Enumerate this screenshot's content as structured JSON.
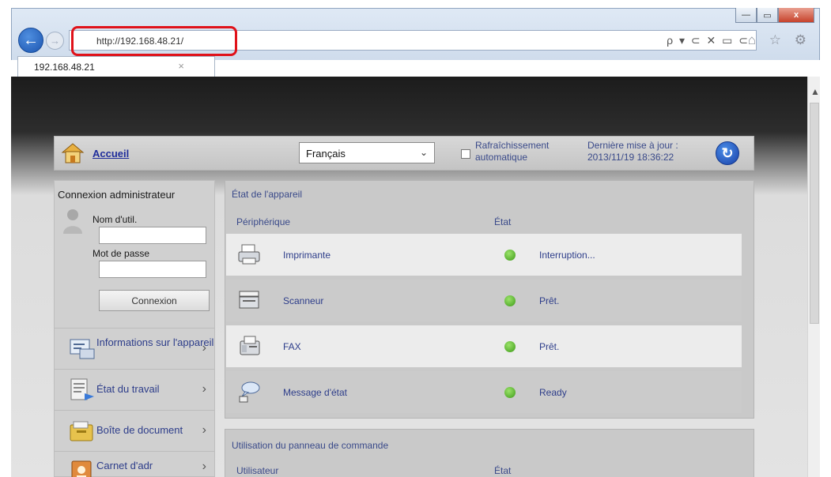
{
  "browser": {
    "url": "http://192.168.48.21/",
    "tab_label": "192.168.48.21",
    "tab_close": "×",
    "address_icons": "ρ ▾ ⊂ ✕ ▭ ⊂",
    "toolbar_icons": "⌂ ☆ ⚙",
    "window_buttons": {
      "minimize": "—",
      "maximize": "▭",
      "close": "x"
    },
    "accent_color": "#1c55b0",
    "highlight_color": "#e0121a"
  },
  "header": {
    "home_label": "Accueil",
    "language": "Français",
    "auto_refresh_label": "Rafraîchissement automatique",
    "last_update_label": "Dernière mise à jour :",
    "last_update_value": "2013/11/19 18:36:22"
  },
  "login": {
    "title": "Connexion administrateur",
    "username_label": "Nom d'util.",
    "username_value": "",
    "password_label": "Mot de passe",
    "password_value": "",
    "button_label": "Connexion"
  },
  "sidebar": {
    "items": [
      {
        "label": "Informations sur l'appareil",
        "icon": "device-info-icon"
      },
      {
        "label": "État du travail",
        "icon": "job-status-icon"
      },
      {
        "label": "Boîte de document",
        "icon": "document-box-icon"
      },
      {
        "label": "Carnet d'adr",
        "icon": "address-book-icon"
      }
    ]
  },
  "device_status": {
    "title": "État de l'appareil",
    "col_device": "Périphérique",
    "col_state": "État",
    "rows": [
      {
        "device": "Imprimante",
        "state": "Interruption...",
        "icon": "printer-icon",
        "status_color": "#3d9a18"
      },
      {
        "device": "Scanneur",
        "state": "Prêt.",
        "icon": "scanner-icon",
        "status_color": "#3d9a18"
      },
      {
        "device": "FAX",
        "state": "Prêt.",
        "icon": "fax-icon",
        "status_color": "#3d9a18"
      },
      {
        "device": "Message d'état",
        "state": "Ready",
        "icon": "status-message-icon",
        "status_color": "#3d9a18"
      }
    ]
  },
  "control_panel": {
    "title": "Utilisation du panneau de commande",
    "col_user": "Utilisateur",
    "col_state": "État"
  }
}
